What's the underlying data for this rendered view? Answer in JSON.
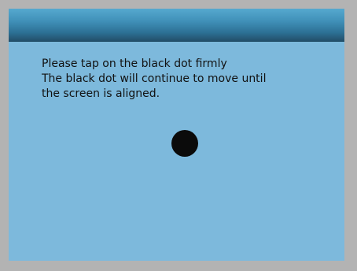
{
  "calibration": {
    "lines": [
      "Please tap on the black dot firmly",
      "The black dot will continue to move until",
      "the screen is aligned."
    ],
    "target_icon": "black-dot-icon"
  },
  "colors": {
    "background": "#7db9dc",
    "titlebar_top": "#56a9cf",
    "titlebar_bottom": "#234f6a",
    "dot": "#0b0b0b",
    "frame": "#b3b3b3"
  }
}
